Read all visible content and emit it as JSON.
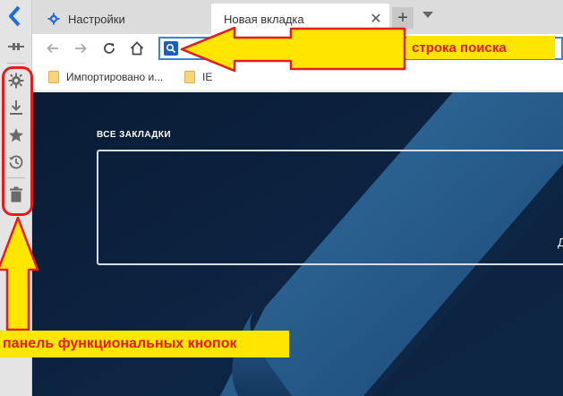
{
  "tabs": [
    {
      "title": "Настройки",
      "icon": "gear-icon"
    },
    {
      "title": "Новая вкладка",
      "icon": ""
    }
  ],
  "new_tab_label": "+",
  "bookmarks_bar": [
    {
      "label": "Импортировано и...",
      "icon": "folder-icon"
    },
    {
      "label": "IE",
      "icon": "folder-icon"
    }
  ],
  "side_panel": {
    "buttons": [
      "pin-icon",
      "gear-icon",
      "download-icon",
      "star-icon",
      "history-icon",
      "trash-icon"
    ]
  },
  "content": {
    "heading": "ВСЕ ЗАКЛАДКИ",
    "box_text": "Д"
  },
  "annotations": {
    "search_bar_label": "строка поиска",
    "panel_label": "панель функциональных кнопок"
  },
  "colors": {
    "accent": "#1c5dbd",
    "annotation_fill": "#ffe600",
    "annotation_text": "#e11b1b",
    "page_background": "#0d2340",
    "highlight": "#3b84d6"
  }
}
